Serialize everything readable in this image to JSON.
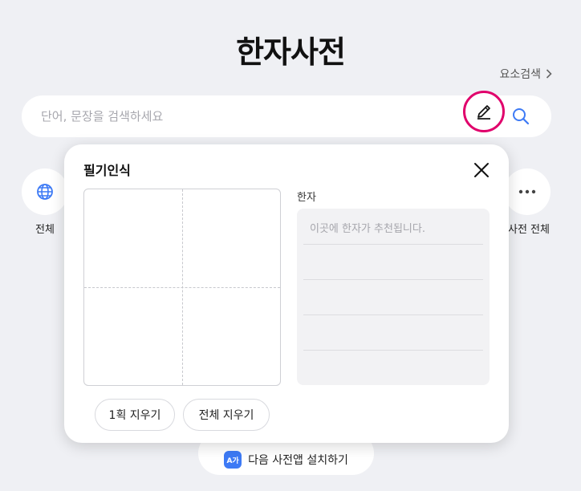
{
  "header": {
    "title": "한자사전",
    "element_search_label": "요소검색"
  },
  "search": {
    "placeholder": "단어, 문장을 검색하세요",
    "value": ""
  },
  "categories": [
    {
      "label": "전체",
      "icon": "globe-icon"
    },
    {
      "label": "사전 전체",
      "icon": "more-icon"
    }
  ],
  "handwriting_panel": {
    "title": "필기인식",
    "result_label": "한자",
    "result_placeholder": "이곳에 한자가 추천됩니다.",
    "undo_stroke_label": "1획 지우기",
    "clear_all_label": "전체 지우기"
  },
  "install_banner": {
    "icon_text": "A가",
    "label": "다음 사전앱 설치하기"
  },
  "colors": {
    "background": "#eff0f4",
    "highlight_ring": "#e0006b",
    "accent_blue": "#3d7af5"
  }
}
